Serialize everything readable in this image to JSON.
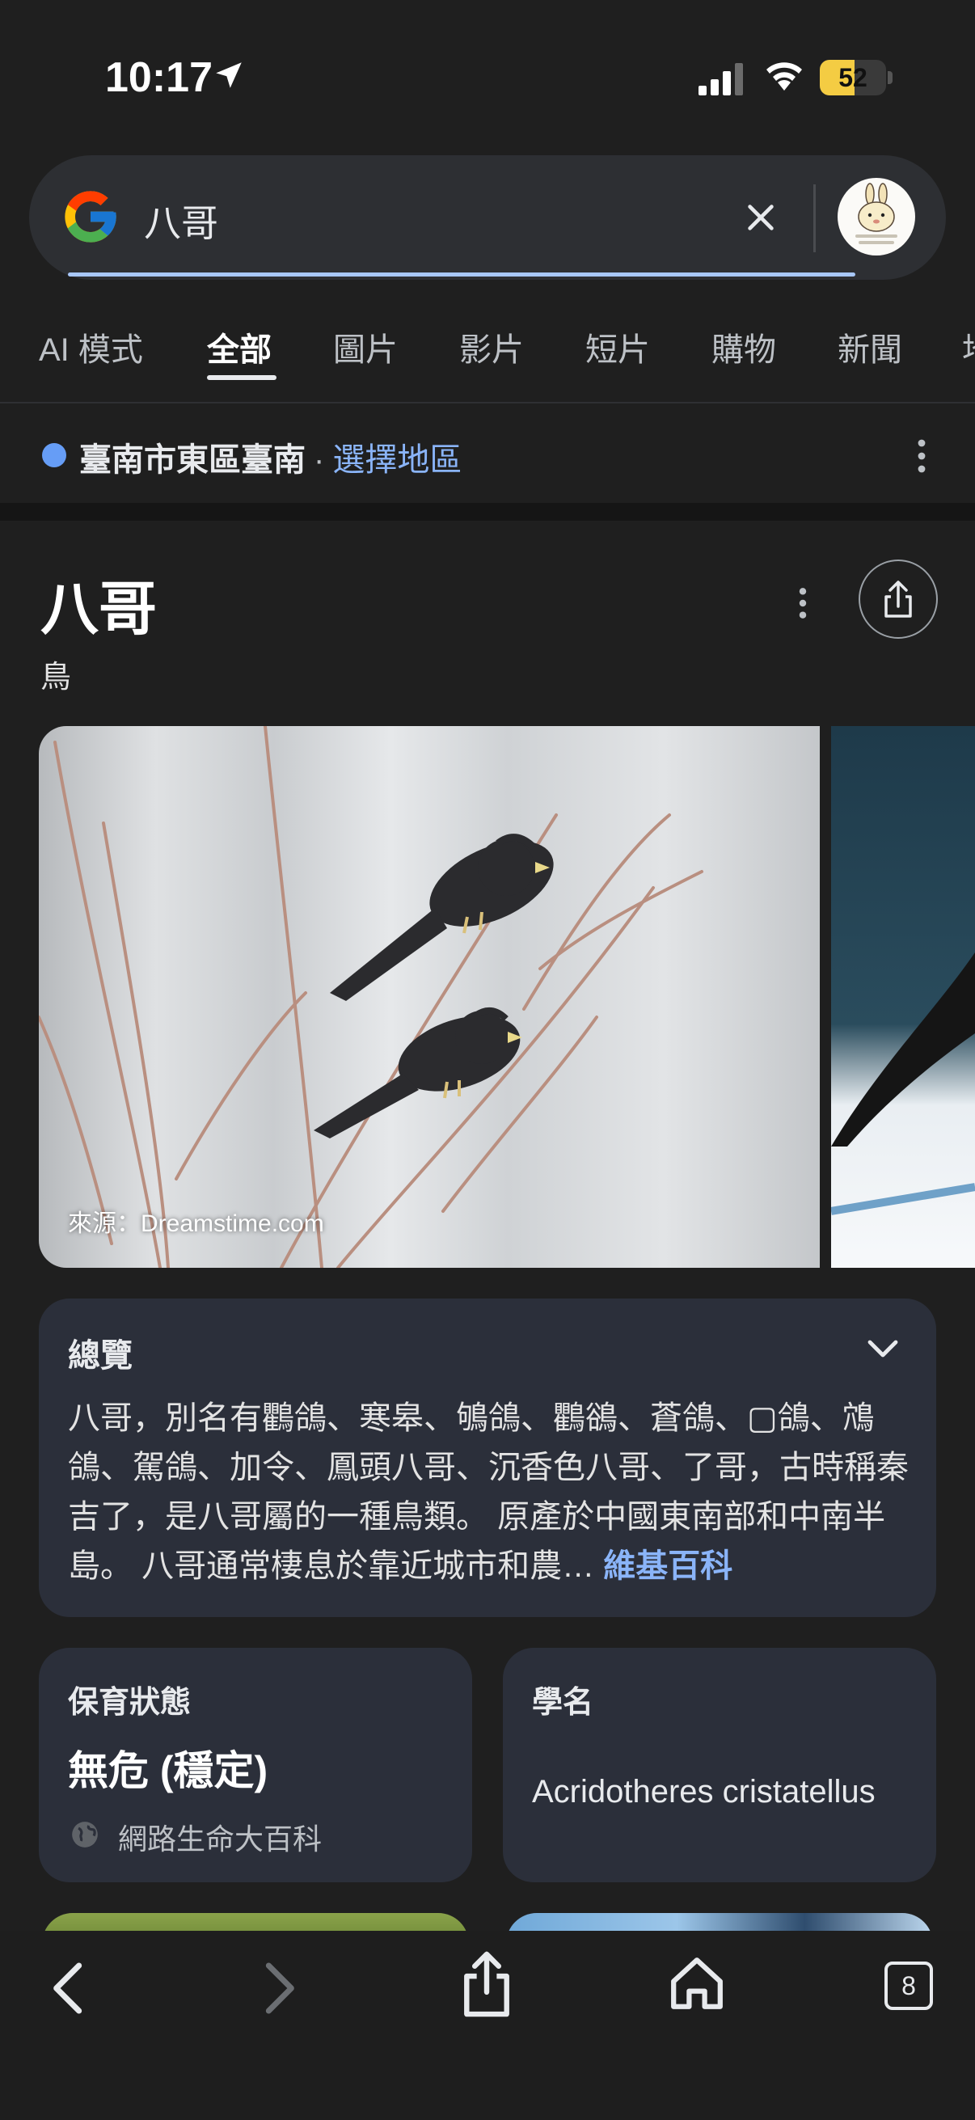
{
  "status": {
    "time": "10:17",
    "battery": "52",
    "battery_level": 0.52
  },
  "search": {
    "query": "八哥"
  },
  "tabs": [
    {
      "label": "AI 模式"
    },
    {
      "label": "全部",
      "active": true
    },
    {
      "label": "圖片"
    },
    {
      "label": "影片"
    },
    {
      "label": "短片"
    },
    {
      "label": "購物"
    },
    {
      "label": "新聞"
    },
    {
      "label": "地"
    }
  ],
  "location": {
    "name": "臺南市東區臺南",
    "separator": "·",
    "link": "選擇地區"
  },
  "panel": {
    "title": "八哥",
    "subtitle": "鳥",
    "image_caption": "來源：Dreamstime.com",
    "image_watermark": "dreamstime",
    "overview": {
      "heading": "總覽",
      "text": "八哥，別名有鸜鴿、寒皋、鴝鴿、鸜鵒、蒼鴿、▢鴿、鴪鴿、駕鴿、加令、鳳頭八哥、沉香色八哥、了哥，古時稱秦吉了，是八哥屬的一種鳥類。 原產於中國東南部和中南半島。 八哥通常棲息於靠近城市和農",
      "ellipsis": "…",
      "source": "維基百科"
    },
    "cards": {
      "conservation": {
        "heading": "保育狀態",
        "value": "無危 (穩定)",
        "source": "網路生命大百科"
      },
      "scientific": {
        "heading": "學名",
        "value": "Acridotheres cristatellus"
      }
    }
  },
  "toolbar": {
    "tab_count": "8"
  },
  "colors": {
    "accent_link": "#8ab4f8",
    "battery": "#f4cc43",
    "card_bg": "#2b2f3a",
    "page_bg": "#1f1f1f"
  },
  "icons": [
    "location-arrow-icon",
    "signal-icon",
    "wifi-icon",
    "google-logo-icon",
    "clear-icon",
    "more-vert-icon",
    "share-icon",
    "chevron-down-icon",
    "globe-icon",
    "back-icon",
    "forward-icon",
    "home-icon",
    "tabs-icon"
  ]
}
